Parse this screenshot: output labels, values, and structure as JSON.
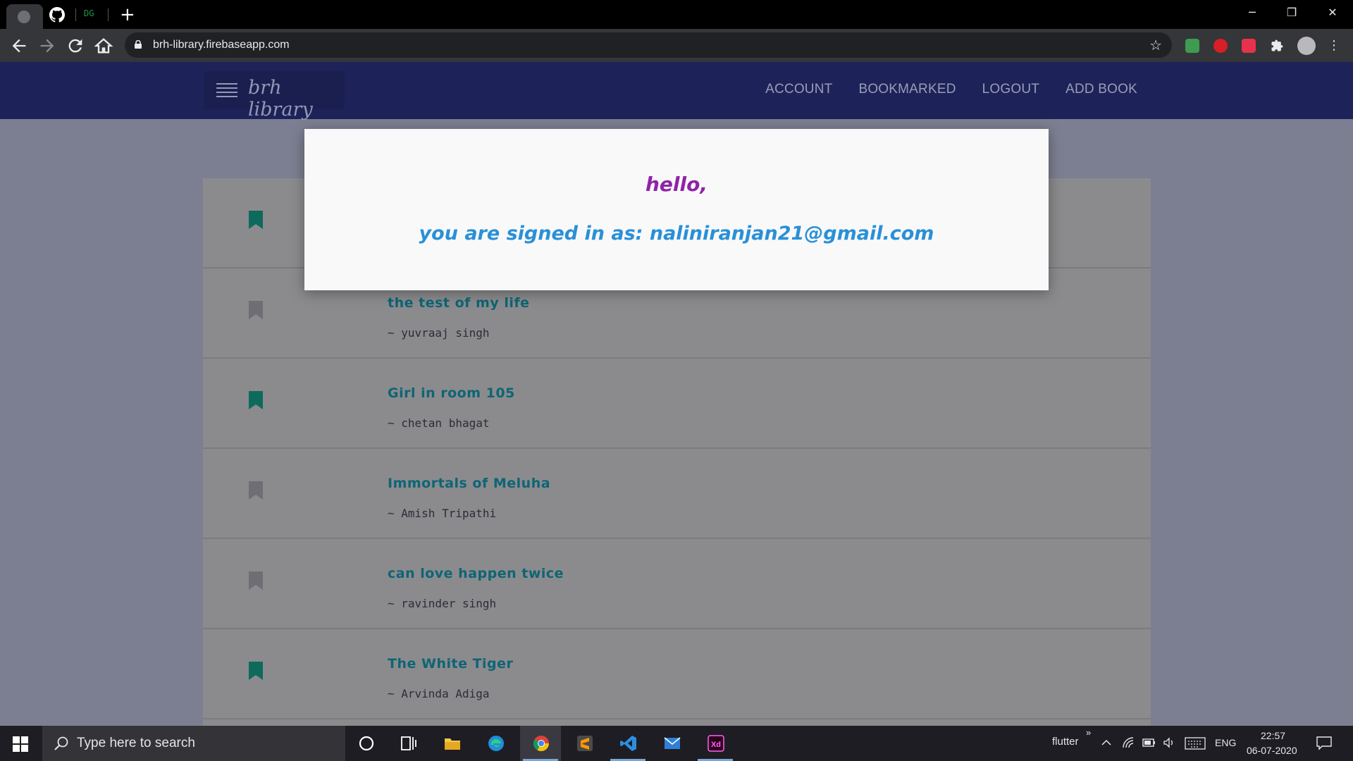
{
  "browser": {
    "tabs": [
      {
        "label": "GitHub"
      },
      {
        "label": "DG"
      }
    ],
    "new_tab_label": "+",
    "window_controls": {
      "minimize": "─",
      "restore": "❐",
      "close": "✕"
    },
    "address": "brh-library.firebaseapp.com",
    "extensions": [
      "gmail-checker-icon",
      "adblock-icon",
      "pocket-icon",
      "puzzle-icon",
      "profile-avatar"
    ]
  },
  "site": {
    "brand": "brh library",
    "nav": [
      "ACCOUNT",
      "BOOKMARKED",
      "LOGOUT",
      "ADD BOOK"
    ]
  },
  "books": [
    {
      "title": "",
      "author": "",
      "bookmarked": true
    },
    {
      "title": "the test of my life",
      "author": "~ yuvraaj singh",
      "bookmarked": false
    },
    {
      "title": "Girl in room 105",
      "author": "~ chetan bhagat",
      "bookmarked": true
    },
    {
      "title": "Immortals of Meluha",
      "author": "~ Amish Tripathi",
      "bookmarked": false
    },
    {
      "title": "can love happen twice",
      "author": "~ ravinder singh",
      "bookmarked": false
    },
    {
      "title": "The White Tiger",
      "author": "~ Arvinda Adiga",
      "bookmarked": true
    }
  ],
  "modal": {
    "greeting": "hello,",
    "signed_in": "you are signed in as: naliniranjan21@gmail.com"
  },
  "taskbar": {
    "search_placeholder": "Type here to search",
    "tray_label": "flutter",
    "tray_chevron": "»",
    "language": "ENG",
    "time": "22:57",
    "date": "06-07-2020"
  },
  "colors": {
    "navbar": "#1d2359",
    "modal_greeting": "#8f23a8",
    "modal_email": "#2990d8",
    "book_title": "#0e6574",
    "bookmark_on": "#0e6a5c",
    "bookmark_off": "#6e6e74"
  }
}
